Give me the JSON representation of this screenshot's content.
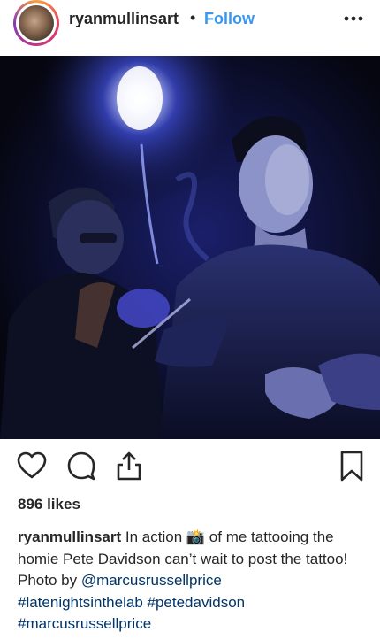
{
  "header": {
    "username": "ryanmullinsart",
    "separator": "•",
    "follow_label": "Follow",
    "more_icon": "more-horizontal-icon"
  },
  "actions": {
    "like_icon": "heart-icon",
    "comment_icon": "comment-icon",
    "share_icon": "share-icon",
    "save_icon": "bookmark-icon"
  },
  "likes_text": "896 likes",
  "caption": {
    "username": "ryanmullinsart",
    "text_part1": "In action",
    "emoji": "📸",
    "text_part2": "of me tattooing the homie Pete Davidson can’t wait to post the tattoo! Photo by",
    "mention": "@marcusrussellprice",
    "hashtags": [
      "#latenightsinthelab",
      "#petedavidson",
      "#marcusrussellprice"
    ]
  },
  "colors": {
    "follow": "#3897f0",
    "link": "#003569",
    "text": "#262626"
  }
}
